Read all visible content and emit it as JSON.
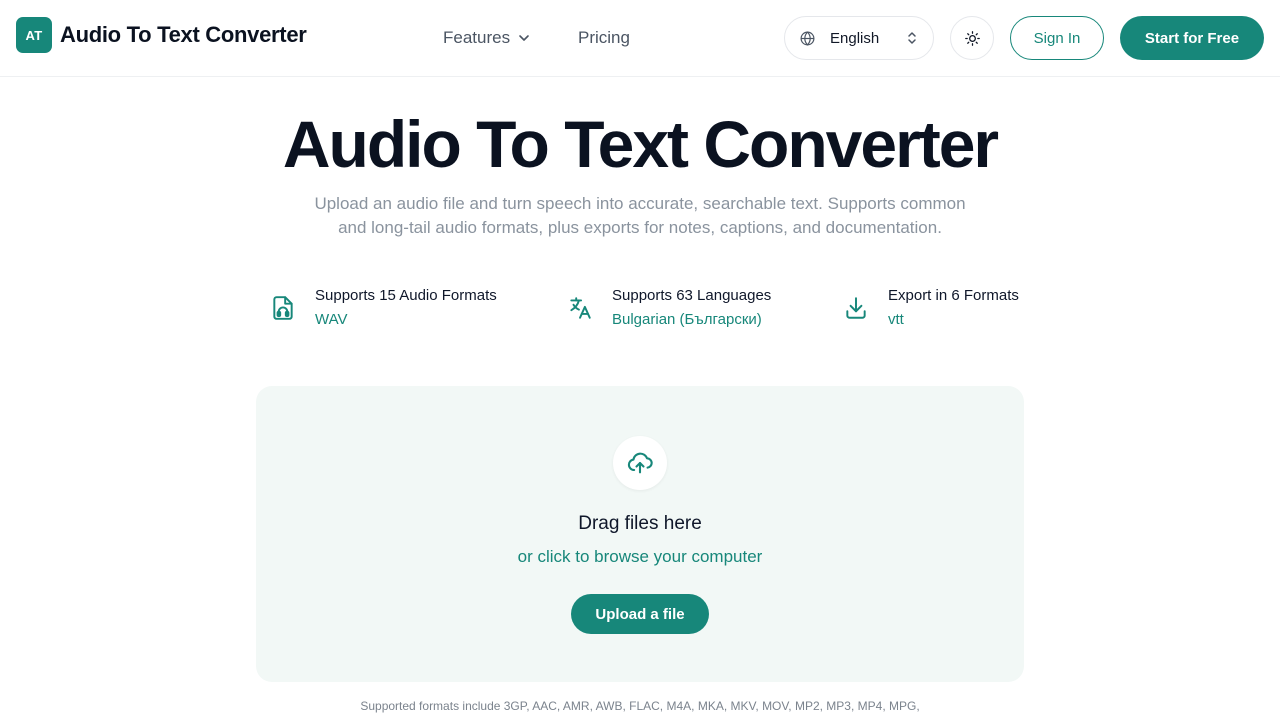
{
  "header": {
    "logo_badge": "AT",
    "logo_text": "Audio To Text Converter",
    "nav": {
      "features": "Features",
      "pricing": "Pricing"
    },
    "language": "English",
    "sign_in": "Sign In",
    "start_free": "Start for Free"
  },
  "hero": {
    "title": "Audio To Text Converter",
    "subtitle": "Upload an audio file and turn speech into accurate, searchable text. Supports common and long-tail audio formats, plus exports for notes, captions, and documentation."
  },
  "features": [
    {
      "title": "Supports 15 Audio Formats",
      "value": "WAV",
      "icon": "audio-file-icon"
    },
    {
      "title": "Supports 63 Languages",
      "value": "Bulgarian (Български)",
      "icon": "translate-icon"
    },
    {
      "title": "Export in 6 Formats",
      "value": "vtt",
      "icon": "download-icon"
    }
  ],
  "upload": {
    "title": "Drag files here",
    "subtitle": "or click to browse your computer",
    "button": "Upload a file",
    "icon": "cloud-upload-icon"
  },
  "formats_note": "Supported formats include 3GP, AAC, AMR, AWB, FLAC, M4A, MKA, MKV, MOV, MP2, MP3, MP4, MPG,",
  "colors": {
    "accent": "#17877a",
    "dropzone_bg": "#f2f8f6",
    "muted_text": "#8a939e"
  }
}
